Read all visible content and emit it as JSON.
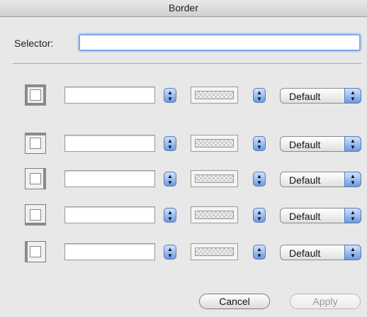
{
  "window": {
    "title": "Border"
  },
  "selector": {
    "label": "Selector:",
    "value": ""
  },
  "rows": [
    {
      "side": "all",
      "icon": "border-all-icon",
      "width_value": "",
      "style": "Default"
    },
    {
      "side": "top",
      "icon": "border-top-icon",
      "width_value": "",
      "style": "Default"
    },
    {
      "side": "right",
      "icon": "border-right-icon",
      "width_value": "",
      "style": "Default"
    },
    {
      "side": "bottom",
      "icon": "border-bottom-icon",
      "width_value": "",
      "style": "Default"
    },
    {
      "side": "left",
      "icon": "border-left-icon",
      "width_value": "",
      "style": "Default"
    }
  ],
  "buttons": {
    "cancel": "Cancel",
    "apply": "Apply"
  },
  "colors": {
    "accent": "#6c9be0",
    "focus_ring": "#7fa8e6"
  }
}
